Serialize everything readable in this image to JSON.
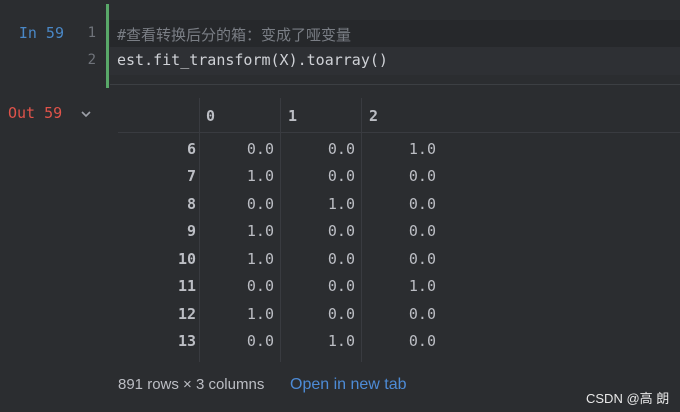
{
  "input_cell": {
    "prompt": "In 59",
    "line_numbers": [
      "1",
      "2"
    ],
    "lines": [
      "#查看转换后分的箱：变成了哑变量",
      "est.fit_transform(X).toarray()"
    ]
  },
  "output_cell": {
    "prompt": "Out 59",
    "collapse_icon": "chevron-down-icon",
    "table": {
      "columns": [
        "0",
        "1",
        "2"
      ],
      "rows": [
        {
          "index": "6",
          "values": [
            "0.0",
            "0.0",
            "1.0"
          ]
        },
        {
          "index": "7",
          "values": [
            "1.0",
            "0.0",
            "0.0"
          ]
        },
        {
          "index": "8",
          "values": [
            "0.0",
            "1.0",
            "0.0"
          ]
        },
        {
          "index": "9",
          "values": [
            "1.0",
            "0.0",
            "0.0"
          ]
        },
        {
          "index": "10",
          "values": [
            "1.0",
            "0.0",
            "0.0"
          ]
        },
        {
          "index": "11",
          "values": [
            "0.0",
            "0.0",
            "1.0"
          ]
        },
        {
          "index": "12",
          "values": [
            "1.0",
            "0.0",
            "0.0"
          ]
        },
        {
          "index": "13",
          "values": [
            "0.0",
            "1.0",
            "0.0"
          ]
        }
      ]
    },
    "shape_text": "891 rows × 3 columns",
    "open_link": "Open in new tab"
  },
  "watermark": "CSDN @高 朗",
  "colors": {
    "background": "#2b2d30",
    "in_prompt": "#4a88c7",
    "out_prompt": "#e0534a",
    "cell_bar": "#59a869",
    "link": "#4d8bd6"
  }
}
